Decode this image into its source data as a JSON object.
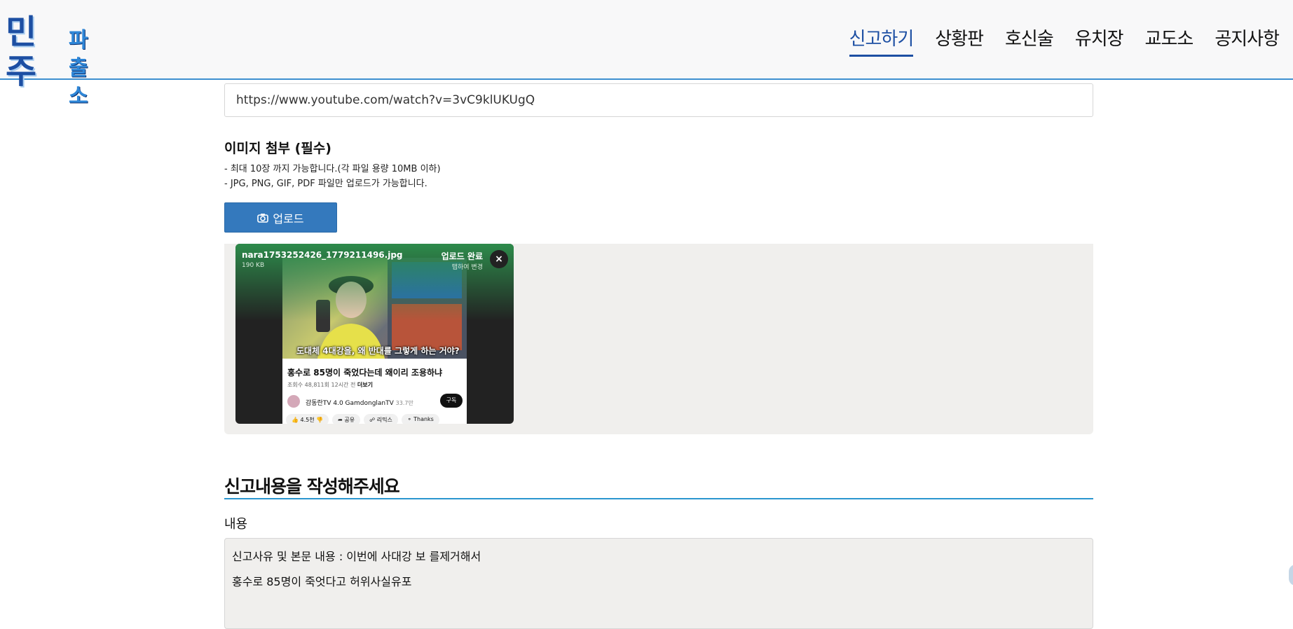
{
  "header": {
    "logo_main": "민주",
    "logo_sub": "파출소",
    "nav": [
      "신고하기",
      "상황판",
      "호신술",
      "유치장",
      "교도소",
      "공지사항"
    ],
    "active_nav": "신고하기"
  },
  "url_field": {
    "value": "https://www.youtube.com/watch?v=3vC9klUKUgQ"
  },
  "image_section": {
    "title": "이미지 첨부 (필수)",
    "hint1": "- 최대 10장 까지 가능합니다.(각 파일 용량 10MB 이하)",
    "hint2": "- JPG, PNG, GIF, PDF 파일만 업로드가 가능합니다.",
    "upload_label": "업로드"
  },
  "preview": {
    "file_name": "nara1753252426_1779211496.jpg",
    "file_size": "190 KB",
    "status": "업로드 완료",
    "status_sub": "탭하여 변경",
    "close": "×",
    "screenshot": {
      "subtitle": "도대체 4대강을, 왜 반대를 그렇게 하는 거야?",
      "video_title": "홍수로 85명이 죽었다는데 왜이리 조용하냐",
      "meta": "조회수 48,811회  12시간 전",
      "more": "더보기",
      "channel": "감동란TV 4.0 GamdonglanTV",
      "subs": "33.7만",
      "subscribe": "구독",
      "actions": [
        "4.5천",
        "공유",
        "리믹스",
        "Thanks"
      ]
    }
  },
  "write_section": {
    "title": "신고내용을 작성해주세요",
    "content_label": "내용",
    "line1": "신고사유 및 본문 내용 : 이번에 사대강 보 를제거해서",
    "line2": "홍수로 85명이 죽엇다고 허위사실유포"
  }
}
